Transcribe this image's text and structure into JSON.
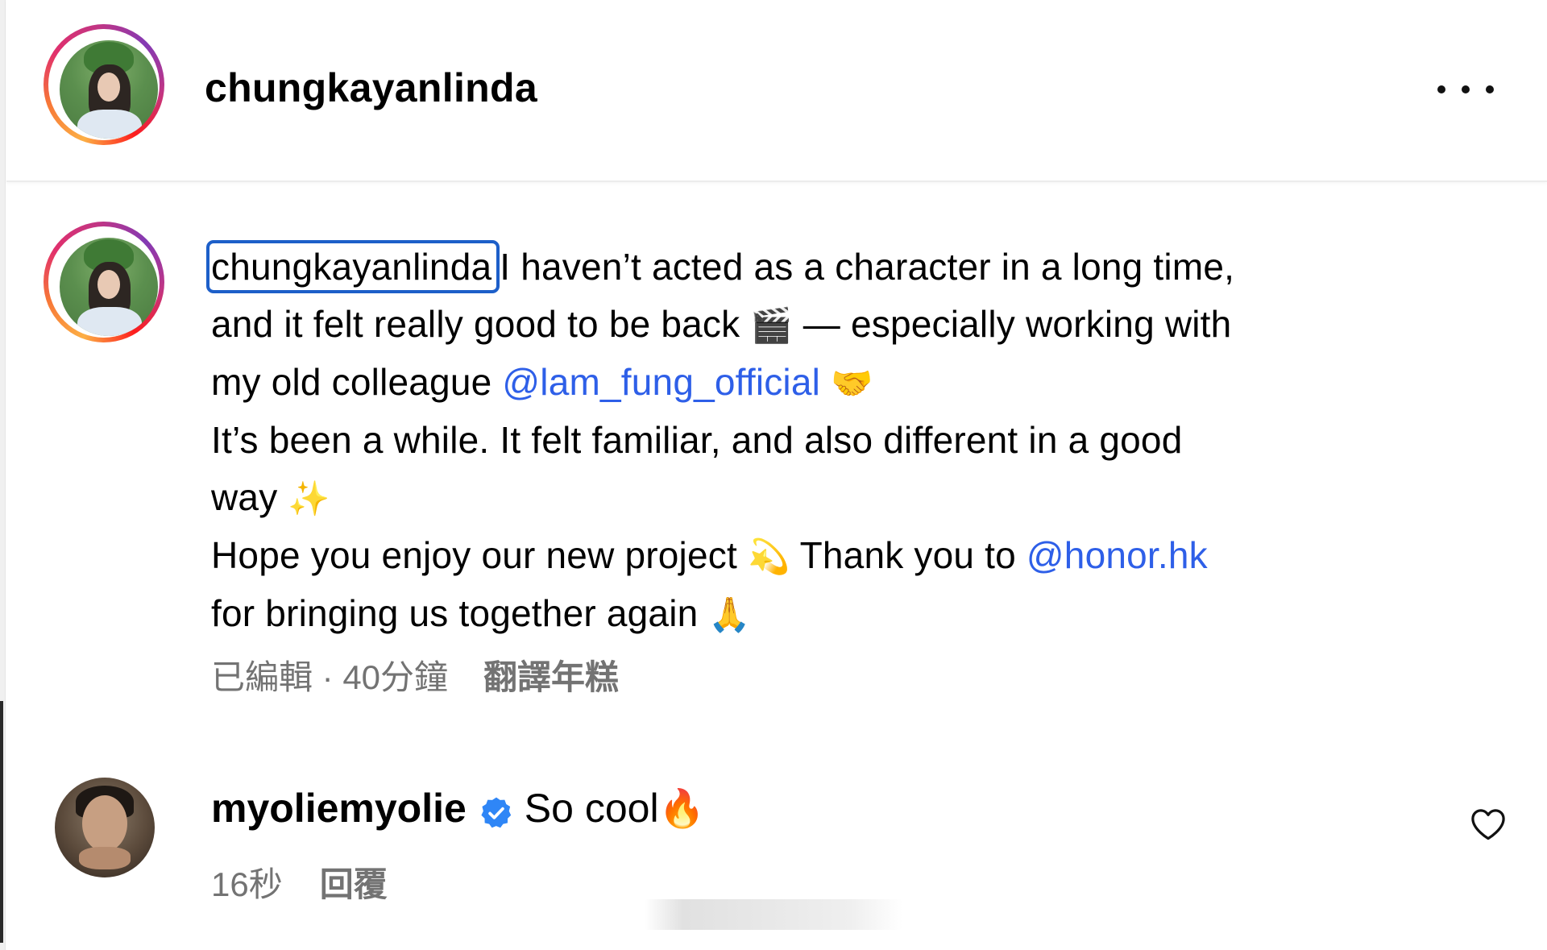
{
  "post": {
    "username": "chungkayanlinda",
    "more_icon": "more-horizontal-icon"
  },
  "caption": {
    "username": "chungkayanlinda",
    "line1_rest": "I haven’t acted as a character in a long time,",
    "line2_text": "and it felt really good to be back ",
    "line2_emoji": "🎬",
    "line2_tail": " — especially working with",
    "line3_text": "my old colleague ",
    "line3_mention": "@lam_fung_official",
    "line3_emoji": "🤝",
    "line4_text": "It’s been a while. It felt familiar, and also different in a good",
    "line5_text": "way ",
    "line5_emoji": "✨",
    "line6_text": "Hope you enjoy our new project ",
    "line6_emoji": "💫",
    "line6_tail": " Thank you to ",
    "line6_mention": "@honor.hk",
    "line7_text": "for bringing us together again ",
    "line7_emoji": "🙏"
  },
  "meta": {
    "edited_time": "已編輯 · 40分鐘",
    "translate_label": "翻譯年糕"
  },
  "comment": {
    "username": "myoliemyolie",
    "verified_icon": "verified-badge-icon",
    "text": "So cool ",
    "emoji": "🔥",
    "time": "16秒",
    "reply_label": "回覆",
    "like_icon": "heart-outline-icon"
  },
  "colors": {
    "mention": "#2e5fe8",
    "highlight_border": "#1d5fc9",
    "meta_text": "#737373",
    "verified": "#2f86f6"
  }
}
